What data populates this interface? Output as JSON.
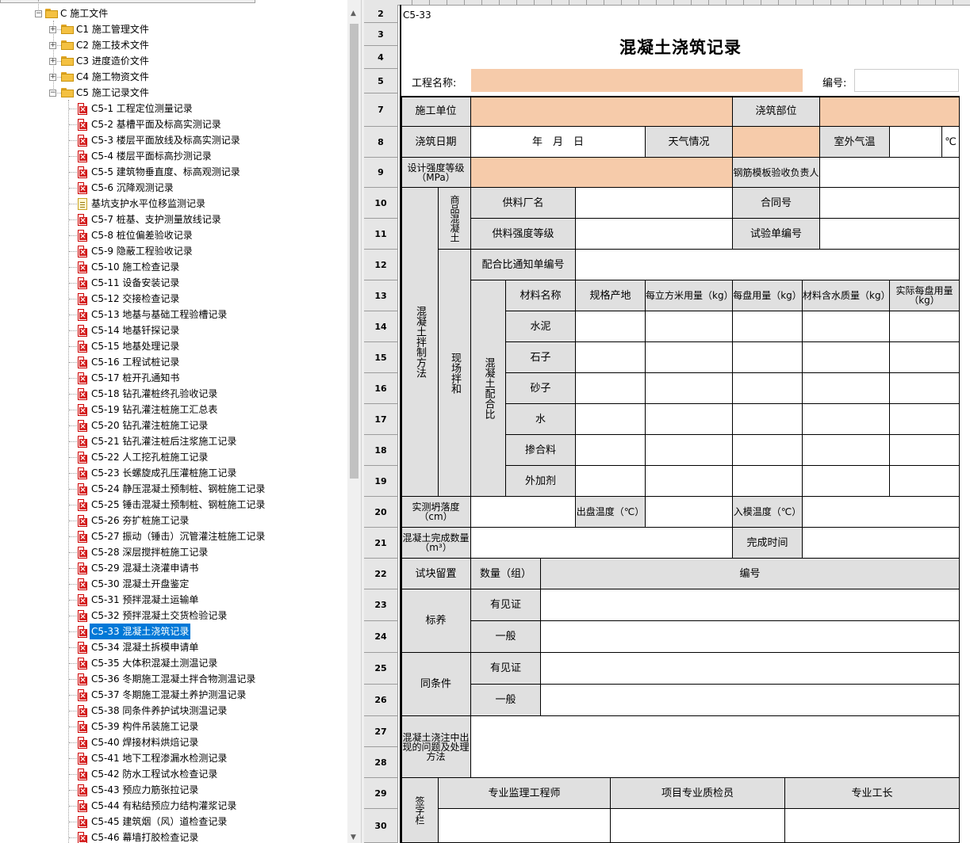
{
  "tree": {
    "root": "C 施工文件",
    "folders": [
      {
        "label": "C1 施工管理文件"
      },
      {
        "label": "C2 施工技术文件"
      },
      {
        "label": "C3 进度造价文件"
      },
      {
        "label": "C4 施工物资文件"
      },
      {
        "label": "C5 施工记录文件"
      }
    ],
    "items": [
      {
        "label": "C5-1 工程定位测量记录",
        "icon": "pdf-x-icon"
      },
      {
        "label": "C5-2 基槽平面及标高实测记录",
        "icon": "pdf-x-icon"
      },
      {
        "label": "C5-3 楼层平面放线及标高实测记录",
        "icon": "pdf-x-icon"
      },
      {
        "label": "C5-4 楼层平面标高抄测记录",
        "icon": "pdf-x-icon"
      },
      {
        "label": "C5-5 建筑物垂直度、标高观测记录",
        "icon": "pdf-x-icon"
      },
      {
        "label": "C5-6 沉降观测记录",
        "icon": "pdf-x-icon"
      },
      {
        "label": "基坑支护水平位移监测记录",
        "icon": "note-icon"
      },
      {
        "label": "C5-7 桩基、支护测量放线记录",
        "icon": "pdf-x-icon"
      },
      {
        "label": "C5-8 桩位偏差验收记录",
        "icon": "pdf-x-icon"
      },
      {
        "label": "C5-9 隐蔽工程验收记录",
        "icon": "pdf-x-icon"
      },
      {
        "label": "C5-10 施工检查记录",
        "icon": "pdf-x-icon"
      },
      {
        "label": "C5-11 设备安装记录",
        "icon": "pdf-x-icon"
      },
      {
        "label": "C5-12 交接检查记录",
        "icon": "pdf-x-icon"
      },
      {
        "label": "C5-13 地基与基础工程验槽记录",
        "icon": "pdf-x-icon"
      },
      {
        "label": "C5-14 地基钎探记录",
        "icon": "pdf-x-icon"
      },
      {
        "label": "C5-15 地基处理记录",
        "icon": "pdf-x-icon"
      },
      {
        "label": "C5-16 工程试桩记录",
        "icon": "pdf-x-icon"
      },
      {
        "label": "C5-17 桩开孔通知书",
        "icon": "pdf-x-icon"
      },
      {
        "label": "C5-18 钻孔灌桩终孔验收记录",
        "icon": "pdf-x-icon"
      },
      {
        "label": "C5-19 钻孔灌注桩施工汇总表",
        "icon": "pdf-x-icon"
      },
      {
        "label": "C5-20 钻孔灌注桩施工记录",
        "icon": "pdf-x-icon"
      },
      {
        "label": "C5-21 钻孔灌注桩后注浆施工记录",
        "icon": "pdf-x-icon"
      },
      {
        "label": "C5-22 人工挖孔桩施工记录",
        "icon": "pdf-x-icon"
      },
      {
        "label": "C5-23 长螺旋成孔压灌桩施工记录",
        "icon": "pdf-x-icon"
      },
      {
        "label": "C5-24 静压混凝土预制桩、钢桩施工记录",
        "icon": "pdf-x-icon"
      },
      {
        "label": "C5-25 锤击混凝土预制桩、钢桩施工记录",
        "icon": "pdf-x-icon"
      },
      {
        "label": "C5-26 夯扩桩施工记录",
        "icon": "pdf-x-icon"
      },
      {
        "label": "C5-27 振动（锤击）沉管灌注桩施工记录",
        "icon": "pdf-x-icon"
      },
      {
        "label": "C5-28 深层搅拌桩施工记录",
        "icon": "pdf-x-icon"
      },
      {
        "label": "C5-29 混凝土浇灌申请书",
        "icon": "pdf-x-icon"
      },
      {
        "label": "C5-30 混凝土开盘鉴定",
        "icon": "pdf-x-icon"
      },
      {
        "label": "C5-31 预拌混凝土运输单",
        "icon": "pdf-x-icon"
      },
      {
        "label": "C5-32 预拌混凝土交货检验记录",
        "icon": "pdf-x-icon"
      },
      {
        "label": "C5-33 混凝土浇筑记录",
        "icon": "pdf-x-icon",
        "selected": true
      },
      {
        "label": "C5-34 混凝土拆模申请单",
        "icon": "pdf-x-icon"
      },
      {
        "label": "C5-35 大体积混凝土测温记录",
        "icon": "pdf-x-icon"
      },
      {
        "label": "C5-36 冬期施工混凝土拌合物测温记录",
        "icon": "pdf-x-icon"
      },
      {
        "label": "C5-37 冬期施工混凝土养护测温记录",
        "icon": "pdf-x-icon"
      },
      {
        "label": "C5-38 同条件养护试块测温记录",
        "icon": "pdf-x-icon"
      },
      {
        "label": "C5-39 构件吊装施工记录",
        "icon": "pdf-x-icon"
      },
      {
        "label": "C5-40 焊接材料烘焙记录",
        "icon": "pdf-x-icon"
      },
      {
        "label": "C5-41 地下工程渗漏水检测记录",
        "icon": "pdf-x-icon"
      },
      {
        "label": "C5-42 防水工程试水检查记录",
        "icon": "pdf-x-icon"
      },
      {
        "label": "C5-43 预应力筋张拉记录",
        "icon": "pdf-x-icon"
      },
      {
        "label": "C5-44 有粘结预应力结构灌浆记录",
        "icon": "pdf-x-icon"
      },
      {
        "label": "C5-45 建筑烟（风）道检查记录",
        "icon": "pdf-x-icon"
      },
      {
        "label": "C5-46 幕墙打胶检查记录",
        "icon": "pdf-x-icon"
      }
    ]
  },
  "sheet": {
    "row_numbers": [
      "2",
      "3",
      "4",
      "5",
      "7",
      "8",
      "9",
      "10",
      "11",
      "12",
      "13",
      "14",
      "15",
      "16",
      "17",
      "18",
      "19",
      "20",
      "21",
      "22",
      "23",
      "24",
      "25",
      "26",
      "27",
      "28",
      "29",
      "30"
    ],
    "doc_code": "C5-33",
    "title": "混凝土浇筑记录",
    "project_name_label": "工程名称:",
    "serial_label": "编号:",
    "cells": {
      "construction_unit": "施工单位",
      "pour_location": "浇筑部位",
      "pour_date": "浇筑日期",
      "date_placeholder": "年　月　日",
      "weather": "天气情况",
      "outdoor_temp": "室外气温",
      "temp_unit": "℃",
      "strength_grade": "设计强度等级（MPa）",
      "rebar_check": "钢筋模板验收负责人",
      "mix_method": "混凝土拌制方法",
      "commercial": "商品混凝土",
      "supplier": "供料厂名",
      "contract_no": "合同号",
      "supply_grade": "供料强度等级",
      "test_no": "试验单编号",
      "site_mix": "现场拌和",
      "mix_notice": "配合比通知单编号",
      "mix_ratio": "混凝土配合比",
      "material_name": "材料名称",
      "spec_origin": "规格产地",
      "per_m3": "每立方米用量（kg）",
      "per_batch": "每盘用量（kg）",
      "moisture": "材料含水质量（kg）",
      "actual_batch": "实际每盘用量（kg）",
      "m_cement": "水泥",
      "m_stone": "石子",
      "m_sand": "砂子",
      "m_water": "水",
      "m_admixture": "掺合料",
      "m_additive": "外加剂",
      "slump": "实测坍落度（cm）",
      "discharge_temp": "出盘温度（℃）",
      "mold_temp": "入模温度（℃）",
      "finish_qty": "混凝土完成数量（m³）",
      "finish_time": "完成时间",
      "specimen": "试块留置",
      "quantity_group": "数量（组）",
      "number": "编号",
      "standard_cure": "标养",
      "witness1": "有见证",
      "general1": "一般",
      "same_cond": "同条件",
      "witness2": "有见证",
      "general2": "一般",
      "problems": "混凝土浇注中出现的问题及处理方法",
      "sign": "签字栏",
      "supervisor": "专业监理工程师",
      "inspector": "项目专业质检员",
      "foreman": "专业工长"
    }
  },
  "colors": {
    "fill": "#f6cbaa",
    "label_bg": "#e0e0e0",
    "selection": "#0078d7"
  }
}
